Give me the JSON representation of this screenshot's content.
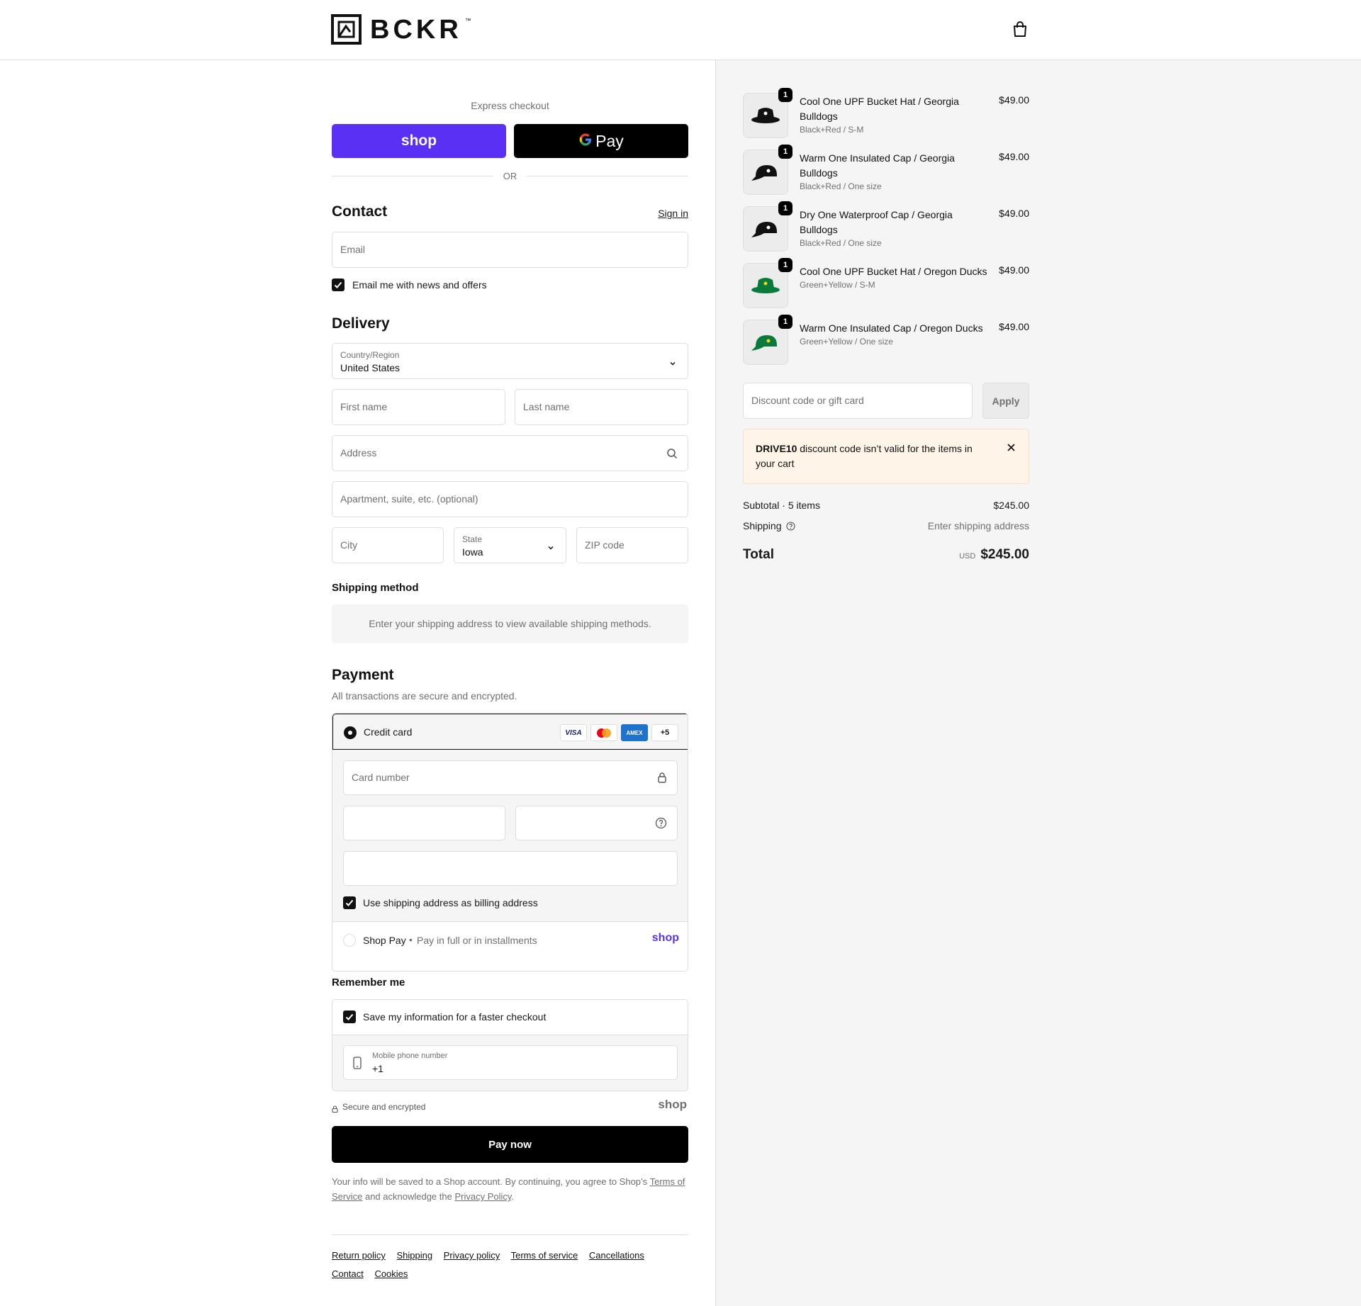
{
  "header": {
    "brand": "BCKR",
    "brand_tm": "™"
  },
  "express": {
    "title": "Express checkout",
    "shop_label": "shop",
    "gpay_label": "Pay",
    "or_label": "OR"
  },
  "contact": {
    "title": "Contact",
    "sign_in": "Sign in",
    "email_placeholder": "Email",
    "news_label": "Email me with news and offers"
  },
  "delivery": {
    "title": "Delivery",
    "country_label": "Country/Region",
    "country_value": "United States",
    "first_name": "First name",
    "last_name": "Last name",
    "address": "Address",
    "apartment": "Apartment, suite, etc. (optional)",
    "city": "City",
    "state_label": "State",
    "state_value": "Iowa",
    "zip": "ZIP code"
  },
  "shipping_method": {
    "title": "Shipping method",
    "message": "Enter your shipping address to view available shipping methods."
  },
  "payment": {
    "title": "Payment",
    "subtitle": "All transactions are secure and encrypted.",
    "credit_card_label": "Credit card",
    "card_brands": [
      "VISA",
      "",
      "AMEX",
      "+5"
    ],
    "card_number_placeholder": "Card number",
    "billing_label": "Use shipping address as billing address",
    "shop_pay_label": "Shop Pay",
    "shop_pay_sub": "Pay in full or in installments",
    "shop_pay_logo": "shop"
  },
  "remember": {
    "title": "Remember me",
    "save_label": "Save my information for a faster checkout",
    "phone_label": "Mobile phone number",
    "phone_value": "+1",
    "secure_label": "Secure and encrypted",
    "shop_logo": "shop"
  },
  "pay_now": "Pay now",
  "legal": {
    "text1": "Your info will be saved to a Shop account. By continuing, you agree to Shop’s ",
    "terms": "Terms of Service",
    "text2": " and acknowledge the ",
    "privacy": "Privacy Policy",
    "text3": "."
  },
  "footer": {
    "links": [
      "Return policy",
      "Shipping",
      "Privacy policy",
      "Terms of service",
      "Cancellations",
      "Contact",
      "Cookies"
    ]
  },
  "cart": {
    "items": [
      {
        "name": "Cool One UPF Bucket Hat / Georgia Bulldogs",
        "variant": "Black+Red / S-M",
        "price": "$49.00",
        "qty": "1",
        "color": "#111111"
      },
      {
        "name": "Warm One Insulated Cap / Georgia Bulldogs",
        "variant": "Black+Red / One size",
        "price": "$49.00",
        "qty": "1",
        "color": "#111111"
      },
      {
        "name": "Dry One Waterproof Cap / Georgia Bulldogs",
        "variant": "Black+Red / One size",
        "price": "$49.00",
        "qty": "1",
        "color": "#111111"
      },
      {
        "name": "Cool One UPF Bucket Hat / Oregon Ducks",
        "variant": "Green+Yellow / S-M",
        "price": "$49.00",
        "qty": "1",
        "color": "#0a7a3c"
      },
      {
        "name": "Warm One Insulated Cap / Oregon Ducks",
        "variant": "Green+Yellow / One size",
        "price": "$49.00",
        "qty": "1",
        "color": "#0a7a3c"
      }
    ],
    "discount_placeholder": "Discount code or gift card",
    "apply_label": "Apply",
    "notice_code": "DRIVE10",
    "notice_text": " discount code isn’t valid for the items in your cart",
    "subtotal_label": "Subtotal · 5 items",
    "subtotal_value": "$245.00",
    "shipping_label": "Shipping",
    "shipping_value": "Enter shipping address",
    "total_label": "Total",
    "currency": "USD",
    "total_value": "$245.00"
  },
  "colors": {
    "shop_purple": "#5a31f4",
    "notice_bg": "#fff4e8"
  }
}
